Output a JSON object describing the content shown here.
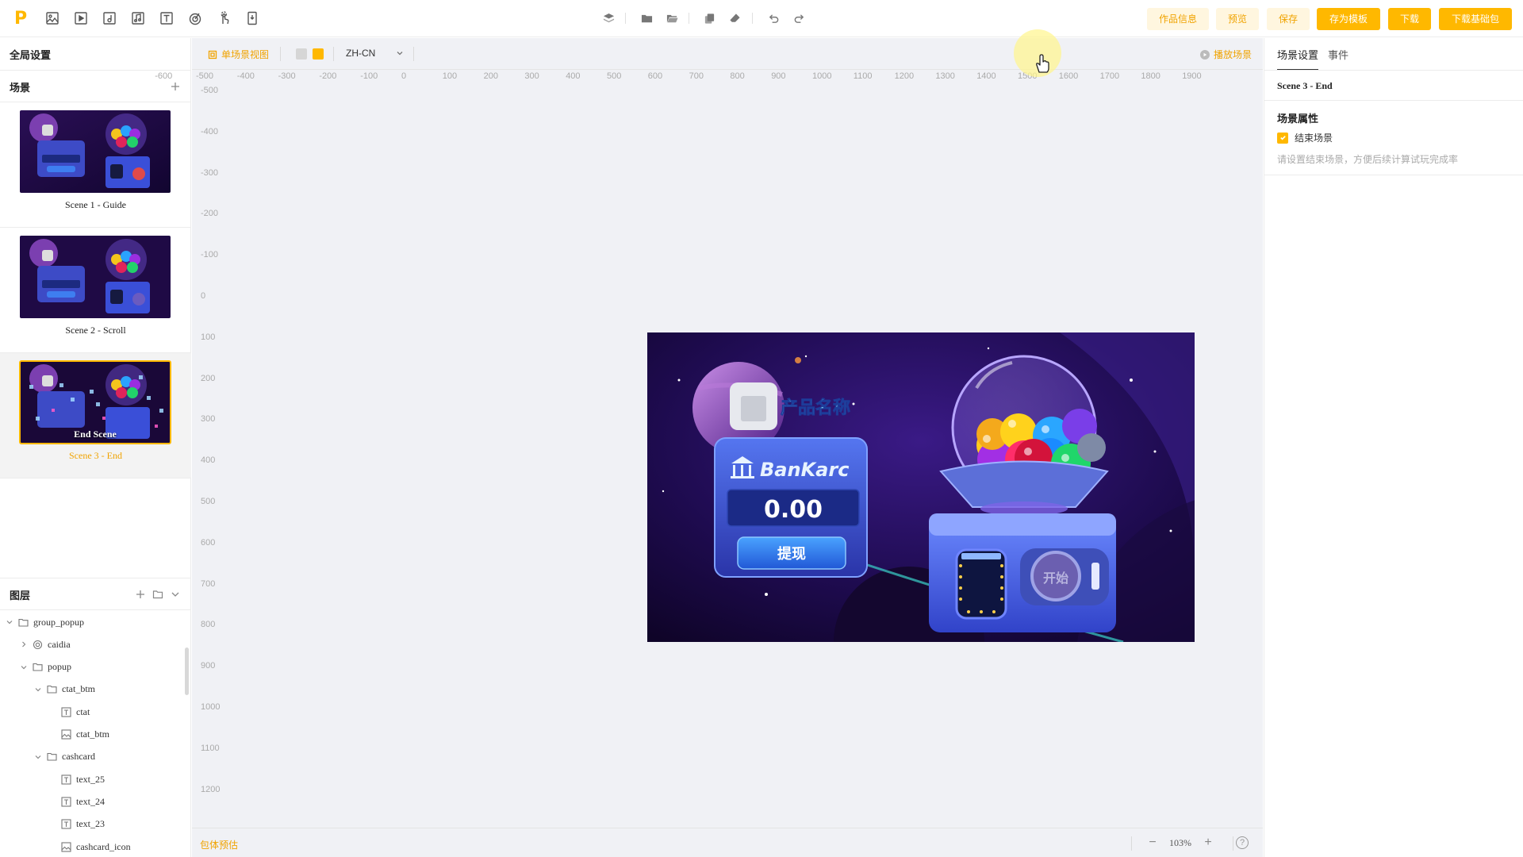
{
  "toolbar": {
    "logo": "P",
    "left_tools": [
      "image-icon",
      "video-icon",
      "audio-icon",
      "music-icon",
      "text-icon",
      "target-icon",
      "gesture-icon",
      "device-icon"
    ],
    "center_tools": [
      "layers-icon",
      "folder-icon",
      "folder-open-icon",
      "copy-icon",
      "clear-icon",
      "undo-icon",
      "redo-icon"
    ],
    "buttons": {
      "work_info": "作品信息",
      "preview": "预览",
      "save": "保存",
      "save_template": "存为模板",
      "download": "下载",
      "download_base": "下载基础包"
    }
  },
  "left": {
    "global_settings": "全局设置",
    "scenes_title": "场景",
    "scenes": [
      {
        "label": "Scene 1 - Guide"
      },
      {
        "label": "Scene 2 - Scroll"
      },
      {
        "label": "Scene 3 - End",
        "overlay": "End Scene",
        "active": true
      }
    ],
    "layers_title": "图层",
    "layers": [
      {
        "name": "group_popup",
        "type": "folder",
        "depth": 0,
        "expand": "open"
      },
      {
        "name": "caidia",
        "type": "target",
        "depth": 1,
        "expand": "closed"
      },
      {
        "name": "popup",
        "type": "folder",
        "depth": 1,
        "expand": "open"
      },
      {
        "name": "ctat_btm",
        "type": "folder",
        "depth": 2,
        "expand": "open"
      },
      {
        "name": "ctat",
        "type": "text",
        "depth": 3,
        "expand": "none"
      },
      {
        "name": "ctat_btm",
        "type": "image",
        "depth": 3,
        "expand": "none"
      },
      {
        "name": "cashcard",
        "type": "folder",
        "depth": 2,
        "expand": "open"
      },
      {
        "name": "text_25",
        "type": "text",
        "depth": 3,
        "expand": "none"
      },
      {
        "name": "text_24",
        "type": "text",
        "depth": 3,
        "expand": "none"
      },
      {
        "name": "text_23",
        "type": "text",
        "depth": 3,
        "expand": "none"
      },
      {
        "name": "cashcard_icon",
        "type": "image",
        "depth": 3,
        "expand": "none"
      }
    ]
  },
  "canvas": {
    "view_mode": "单场景视图",
    "swatch_colors": [
      "#d6d6d6",
      "#ffb800"
    ],
    "language": "ZH-CN",
    "play_scene": "播放场景",
    "ruler_top": [
      "-600",
      "-500",
      "-400",
      "-300",
      "-200",
      "-100",
      "0",
      "100",
      "200",
      "300",
      "400",
      "500",
      "600",
      "700",
      "800",
      "900",
      "1000",
      "1100",
      "1200",
      "1300",
      "1400",
      "1500",
      "1600",
      "1700",
      "1800",
      "1900"
    ],
    "ruler_left": [
      "-500",
      "-400",
      "-300",
      "-200",
      "-100",
      "0",
      "100",
      "200",
      "300",
      "400",
      "500",
      "600",
      "700",
      "800",
      "900",
      "1000",
      "1100",
      "1200"
    ],
    "stage": {
      "product_name": "产品名称",
      "bank_name": "BanKarc",
      "amount": "0.00",
      "withdraw": "提现",
      "start": "开始"
    },
    "package_estimate": "包体预估",
    "zoom": "103%"
  },
  "right": {
    "tabs": [
      "场景设置",
      "事件"
    ],
    "scene_name": "Scene 3 - End",
    "section_title": "场景属性",
    "end_scene_label": "结束场景",
    "end_scene_checked": true,
    "hint": "请设置结束场景，方便后续计算试玩完成率"
  }
}
